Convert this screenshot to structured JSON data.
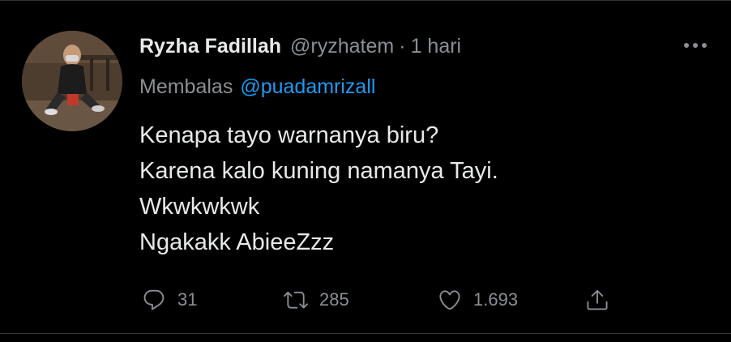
{
  "tweet": {
    "display_name": "Ryzha Fadillah",
    "handle": "@ryzhatem",
    "separator": "·",
    "time": "1 hari",
    "reply_prefix": "Membalas",
    "reply_handle": "@puadamrizall",
    "text_lines": [
      "Kenapa tayo warnanya biru?",
      "Karena kalo kuning namanya Tayi.",
      "Wkwkwkwk",
      "Ngakakk AbieeZzz"
    ]
  },
  "actions": {
    "reply_count": "31",
    "retweet_count": "285",
    "like_count": "1.693"
  },
  "icons": {
    "more": "more-horizontal-icon",
    "reply": "reply-bubble-icon",
    "retweet": "retweet-icon",
    "like": "heart-icon",
    "share": "share-upload-icon"
  },
  "colors": {
    "background": "#000000",
    "primary_text": "#e7e9ea",
    "secondary_text": "#8b8f94",
    "link": "#1d9bf0",
    "divider": "#2f3336"
  }
}
